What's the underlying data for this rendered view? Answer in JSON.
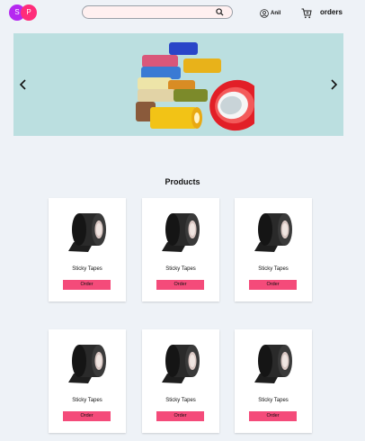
{
  "header": {
    "logo_letters": [
      "S",
      "P"
    ],
    "logo_colors": [
      "#b528f0",
      "#ff2d7a"
    ],
    "search": {
      "placeholder": "",
      "value": "",
      "icon": "search-icon"
    },
    "user_label": "Anil",
    "user_icon": "user-circle-icon",
    "cart_icon": "cart-icon",
    "orders_label": "orders"
  },
  "banner": {
    "prev_icon": "chevron-left-icon",
    "next_icon": "chevron-right-icon",
    "image": "colorful-tape-rolls",
    "background": "#bbdfe0"
  },
  "products": {
    "title": "Products",
    "accent": "#f44b7a",
    "items": [
      {
        "name": "Sticky Tapes",
        "button": "Order"
      },
      {
        "name": "Sticky Tapes",
        "button": "Order"
      },
      {
        "name": "Sticky Tapes",
        "button": "Order"
      },
      {
        "name": "Sticky Tapes",
        "button": "Order"
      },
      {
        "name": "Sticky Tapes",
        "button": "Order"
      },
      {
        "name": "Sticky Tapes",
        "button": "Order"
      }
    ]
  }
}
